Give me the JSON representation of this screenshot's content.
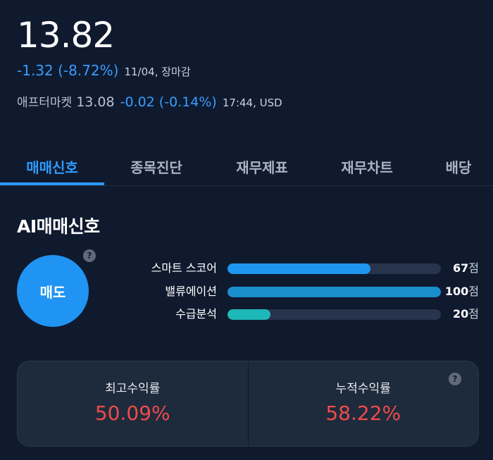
{
  "quote": {
    "price": "13.82",
    "change": "-1.32 (-8.72%)",
    "date_status": "11/04, 장마감",
    "after_market_label": "애프터마켓",
    "after_market_price": "13.08",
    "after_market_change": "-0.02 (-0.14%)",
    "after_market_time": "17:44, USD"
  },
  "tabs": [
    {
      "label": "매매신호",
      "active": true
    },
    {
      "label": "종목진단",
      "active": false
    },
    {
      "label": "재무제표",
      "active": false
    },
    {
      "label": "재무차트",
      "active": false
    },
    {
      "label": "배당",
      "active": false
    }
  ],
  "ai_signal": {
    "title": "AI매매신호",
    "signal": "매도",
    "help_icon": "question-icon",
    "scores": [
      {
        "label": "스마트 스코어",
        "value": "67",
        "unit": "점",
        "fraction": 0.67,
        "color": "#1e96f0"
      },
      {
        "label": "밸류에이션",
        "value": "100",
        "unit": "점",
        "fraction": 1.0,
        "color": "#1a8fcd"
      },
      {
        "label": "수급분석",
        "value": "20",
        "unit": "점",
        "fraction": 0.2,
        "color": "#1fb8b8"
      }
    ]
  },
  "returns": {
    "max": {
      "label": "최고수익률",
      "value": "50.09%"
    },
    "cumulative": {
      "label": "누적수익률",
      "value": "58.22%"
    }
  },
  "colors": {
    "background": "#0f1a2e",
    "accent": "#2d9bff",
    "negative_blue": "#3b9cff",
    "return_red": "#ef4b4b"
  }
}
